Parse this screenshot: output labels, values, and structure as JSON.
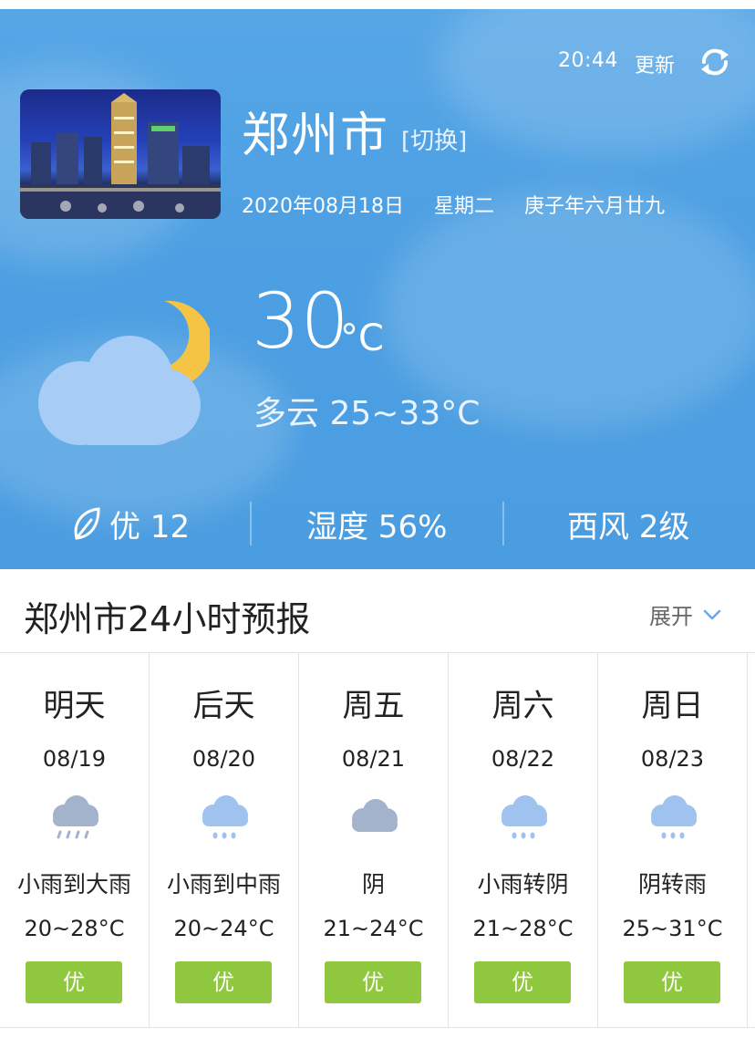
{
  "header": {
    "update_time": "20:44",
    "update_label": "更新",
    "city": "郑州市",
    "switch_label": "[切换]",
    "date": "2020年08月18日",
    "weekday": "星期二",
    "lunar": "庚子年六月廿九"
  },
  "current": {
    "temp": "30",
    "unit": "°C",
    "condition_line": "多云 25~33°C",
    "icon": "cloudy-night-icon"
  },
  "stats": {
    "air_quality": "优 12",
    "humidity": "湿度 56%",
    "wind": "西风 2级"
  },
  "forecast": {
    "title": "郑州市24小时预报",
    "expand_label": "展开",
    "days": [
      {
        "name": "明天",
        "date": "08/19",
        "condition": "小雨到大雨",
        "temp": "20~28°C",
        "aq": "优",
        "icon": "heavy-rain-icon"
      },
      {
        "name": "后天",
        "date": "08/20",
        "condition": "小雨到中雨",
        "temp": "20~24°C",
        "aq": "优",
        "icon": "rain-icon"
      },
      {
        "name": "周五",
        "date": "08/21",
        "condition": "阴",
        "temp": "21~24°C",
        "aq": "优",
        "icon": "overcast-icon"
      },
      {
        "name": "周六",
        "date": "08/22",
        "condition": "小雨转阴",
        "temp": "21~28°C",
        "aq": "优",
        "icon": "rain-icon"
      },
      {
        "name": "周日",
        "date": "08/23",
        "condition": "阴转雨",
        "temp": "25~31°C",
        "aq": "优",
        "icon": "rain-icon"
      }
    ]
  },
  "colors": {
    "hero_blue": "#4c9fe2",
    "aq_green": "#8fc73e",
    "moon_yellow": "#f6c445",
    "cloud_light": "#a7cdf7"
  }
}
